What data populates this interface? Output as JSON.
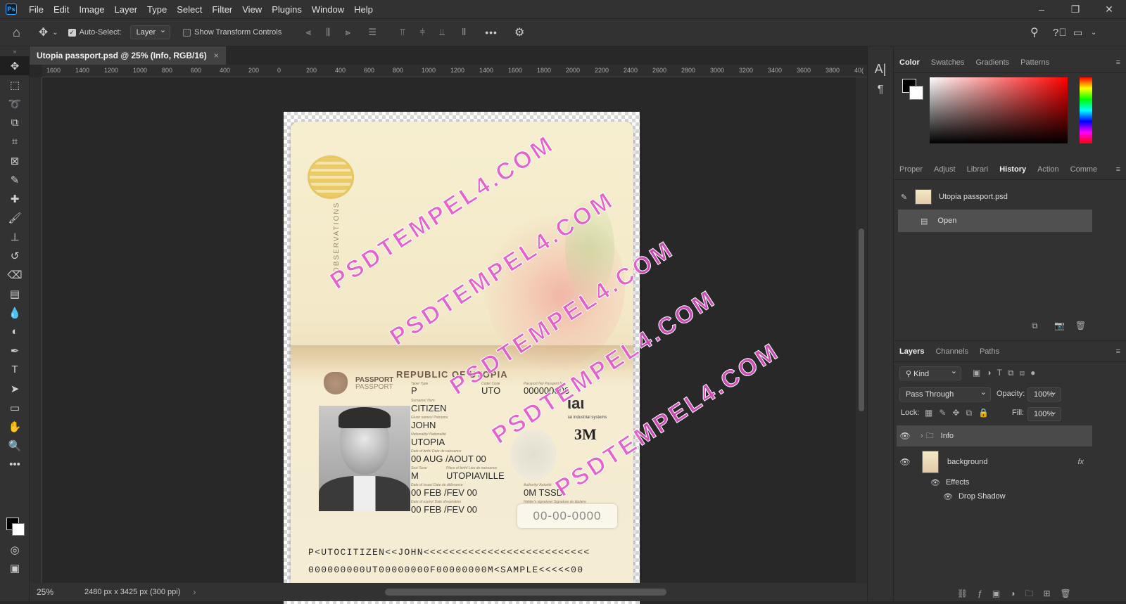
{
  "app": {
    "logo": "Ps"
  },
  "menu": [
    "File",
    "Edit",
    "Image",
    "Layer",
    "Type",
    "Select",
    "Filter",
    "View",
    "Plugins",
    "Window",
    "Help"
  ],
  "window_controls": {
    "minimize": "–",
    "restore": "❐",
    "close": "✕"
  },
  "options": {
    "auto_select_label": "Auto-Select:",
    "auto_select_target": "Layer",
    "transform_label": "Show Transform Controls",
    "more": "•••"
  },
  "document": {
    "tab_title": "Utopia passport.psd @ 25% (Info, RGB/16)",
    "close": "×"
  },
  "ruler": [
    "1600",
    "1400",
    "1200",
    "1000",
    "800",
    "600",
    "400",
    "200",
    "0",
    "200",
    "400",
    "600",
    "800",
    "1000",
    "1200",
    "1400",
    "1600",
    "1800",
    "2000",
    "2200",
    "2400",
    "2600",
    "2800",
    "3000",
    "3200",
    "3400",
    "3600",
    "3800",
    "40("
  ],
  "status": {
    "zoom": "25%",
    "info": "2480 px x 3425 px (300 ppi)"
  },
  "passport": {
    "observations": "OBSERVATIONS",
    "republic": "REPUBLIC OF UTOPIA",
    "passport_label": "PASSPORT",
    "passport_label2": "PASSPORT",
    "lbl_type": "Type/ Type",
    "lbl_code": "Code/ Code",
    "lbl_passno": "Passport No/ Passport No",
    "type": "P",
    "code": "UTO",
    "number": "000000000",
    "lbl_surname": "Surname/ Nom",
    "surname": "CITIZEN",
    "lbl_given": "Given names/ Prénoms",
    "given": "JOHN",
    "lbl_nat": "Nationality/ Nationalité",
    "nationality": "UTOPIA",
    "lbl_dob": "Date of birth/ Date de naissance",
    "dob": "00 AUG /AOUT 00",
    "lbl_sex": "Sex/ Sexe",
    "lbl_pob": "Place of birth/ Lieu de naissance",
    "sex": "M",
    "pob": "UTOPIAVILLE",
    "lbl_issue": "Date of issue/ Date de délivrance",
    "issue": "00 FEB /FEV 00",
    "lbl_expiry": "Date of expiry/ Date d'expiration",
    "expiry": "00 FEB /FEV 00",
    "lbl_auth": "Authority/ Autorité",
    "authority": "0M TSSD",
    "lbl_sig": "Holder's signature/ Signature du titulaire",
    "datebox": "00-00-0000",
    "iai": "ιaι",
    "iai_sub": "iai industrial systems",
    "m3": "3M",
    "mrz1": "P<UTOCITIZEN<<JOHN<<<<<<<<<<<<<<<<<<<<<<<<<<",
    "mrz2": "000000000UT00000000F00000000M<SAMPLE<<<<<00"
  },
  "watermark": "PSDTEMPEL4.COM",
  "color_panel": {
    "tabs": [
      "Color",
      "Swatches",
      "Gradients",
      "Patterns"
    ]
  },
  "history_panel": {
    "tabs": [
      "Proper",
      "Adjust",
      "Librari",
      "History",
      "Action",
      "Comme"
    ],
    "snapshot": "Utopia passport.psd",
    "states": [
      "Open"
    ]
  },
  "layers_panel": {
    "tabs": [
      "Layers",
      "Channels",
      "Paths"
    ],
    "kind": "Kind",
    "blend": "Pass Through",
    "opacity_label": "Opacity:",
    "opacity": "100%",
    "lock_label": "Lock:",
    "fill_label": "Fill:",
    "fill": "100%",
    "layers": [
      {
        "name": "Info"
      },
      {
        "name": "background",
        "fx": "fx"
      }
    ],
    "effects_label": "Effects",
    "drop_shadow": "Drop Shadow"
  }
}
